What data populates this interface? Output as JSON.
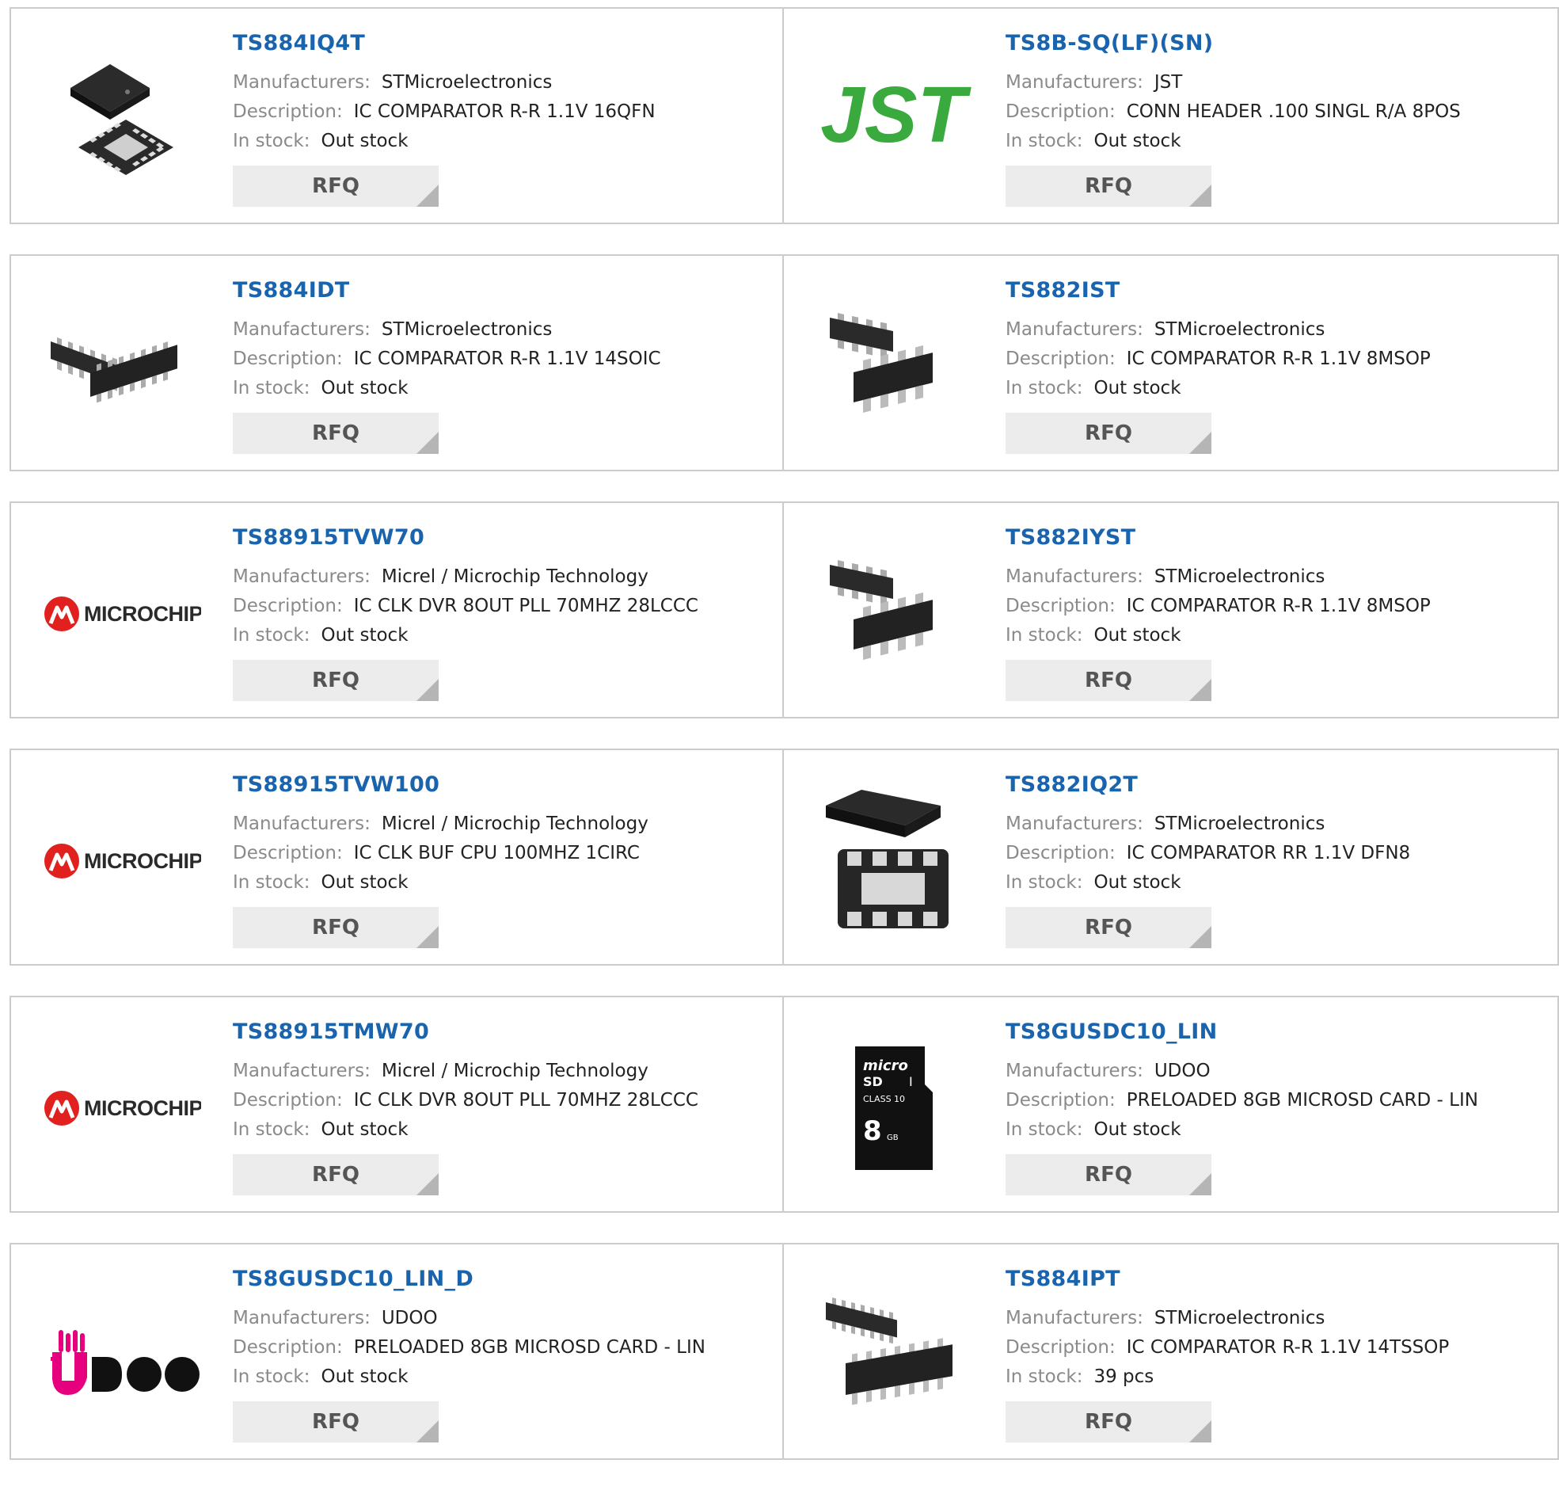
{
  "labels": {
    "manufacturers": "Manufacturers:",
    "description": "Description:",
    "in_stock": "In stock:",
    "rfq": "RFQ"
  },
  "products": [
    {
      "part": "TS884IQ4T",
      "manufacturer": "STMicroelectronics",
      "description": "IC COMPARATOR R-R 1.1V 16QFN",
      "stock": "Out stock",
      "image": "qfn16-chip-icon"
    },
    {
      "part": "TS8B-SQ(LF)(SN)",
      "manufacturer": "JST",
      "description": "CONN HEADER .100 SINGL R/A 8POS",
      "stock": "Out stock",
      "image": "jst-logo",
      "logo_text": "JST"
    },
    {
      "part": "TS884IDT",
      "manufacturer": "STMicroelectronics",
      "description": "IC COMPARATOR R-R 1.1V 14SOIC",
      "stock": "Out stock",
      "image": "soic14-chip-icon"
    },
    {
      "part": "TS882IST",
      "manufacturer": "STMicroelectronics",
      "description": "IC COMPARATOR R-R 1.1V 8MSOP",
      "stock": "Out stock",
      "image": "msop8-chip-icon"
    },
    {
      "part": "TS88915TVW70",
      "manufacturer": "Micrel / Microchip Technology",
      "description": "IC CLK DVR 8OUT PLL 70MHZ 28LCCC",
      "stock": "Out stock",
      "image": "microchip-logo",
      "logo_text": "MICROCHIP"
    },
    {
      "part": "TS882IYST",
      "manufacturer": "STMicroelectronics",
      "description": "IC COMPARATOR R-R 1.1V 8MSOP",
      "stock": "Out stock",
      "image": "msop8-chip-icon"
    },
    {
      "part": "TS88915TVW100",
      "manufacturer": "Micrel / Microchip Technology",
      "description": "IC CLK BUF CPU 100MHZ 1CIRC",
      "stock": "Out stock",
      "image": "microchip-logo",
      "logo_text": "MICROCHIP"
    },
    {
      "part": "TS882IQ2T",
      "manufacturer": "STMicroelectronics",
      "description": "IC COMPARATOR RR 1.1V DFN8",
      "stock": "Out stock",
      "image": "dfn8-chip-icon"
    },
    {
      "part": "TS88915TMW70",
      "manufacturer": "Micrel / Microchip Technology",
      "description": "IC CLK DVR 8OUT PLL 70MHZ 28LCCC",
      "stock": "Out stock",
      "image": "microchip-logo",
      "logo_text": "MICROCHIP"
    },
    {
      "part": "TS8GUSDC10_LIN",
      "manufacturer": "UDOO",
      "description": "PRELOADED 8GB MICROSD CARD - LIN",
      "stock": "Out stock",
      "image": "microsd-card-icon"
    },
    {
      "part": "TS8GUSDC10_LIN_D",
      "manufacturer": "UDOO",
      "description": "PRELOADED 8GB MICROSD CARD - LIN",
      "stock": "Out stock",
      "image": "udoo-logo"
    },
    {
      "part": "TS884IPT",
      "manufacturer": "STMicroelectronics",
      "description": "IC COMPARATOR R-R 1.1V 14TSSOP",
      "stock": "39 pcs",
      "image": "tssop14-chip-icon"
    }
  ]
}
